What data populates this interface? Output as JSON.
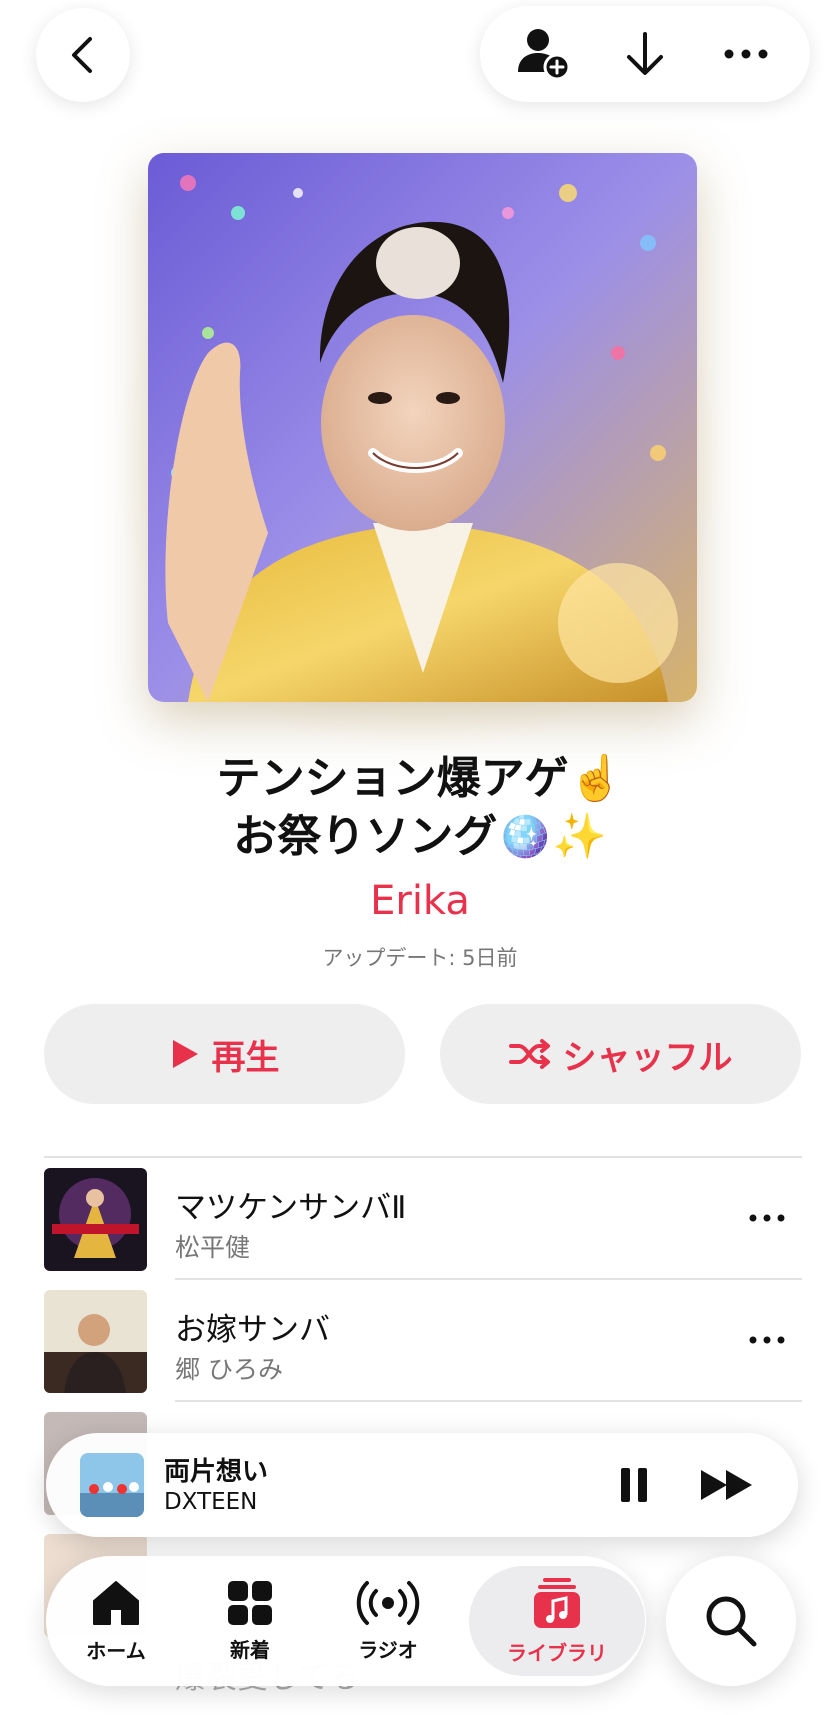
{
  "colors": {
    "accent": "#e8324c",
    "secondary_text": "#777777",
    "button_bg": "#eeeeef"
  },
  "header": {
    "icons": [
      "chevron-left-icon",
      "person-add-icon",
      "download-arrow-icon",
      "more-icon"
    ]
  },
  "playlist": {
    "title_line1": "テンション爆アゲ☝️",
    "title_line2": "お祭りソング🪩✨",
    "curator": "Erika",
    "updated": "アップデート: 5日前",
    "play_label": "再生",
    "shuffle_label": "シャッフル"
  },
  "tracks": [
    {
      "title": "マツケンサンバⅡ",
      "artist": "松平健"
    },
    {
      "title": "お嫁サンバ",
      "artist": "郷 ひろみ"
    },
    {
      "title": "",
      "artist": ""
    },
    {
      "title": "",
      "artist": ""
    },
    {
      "title": "爆裂愛してる",
      "artist": ""
    }
  ],
  "now_playing": {
    "title": "両片想い",
    "artist": "DXTEEN"
  },
  "tabs": [
    {
      "label": "ホーム",
      "icon": "home-icon"
    },
    {
      "label": "新着",
      "icon": "grid-icon"
    },
    {
      "label": "ラジオ",
      "icon": "radio-icon"
    },
    {
      "label": "ライブラリ",
      "icon": "library-icon"
    }
  ]
}
